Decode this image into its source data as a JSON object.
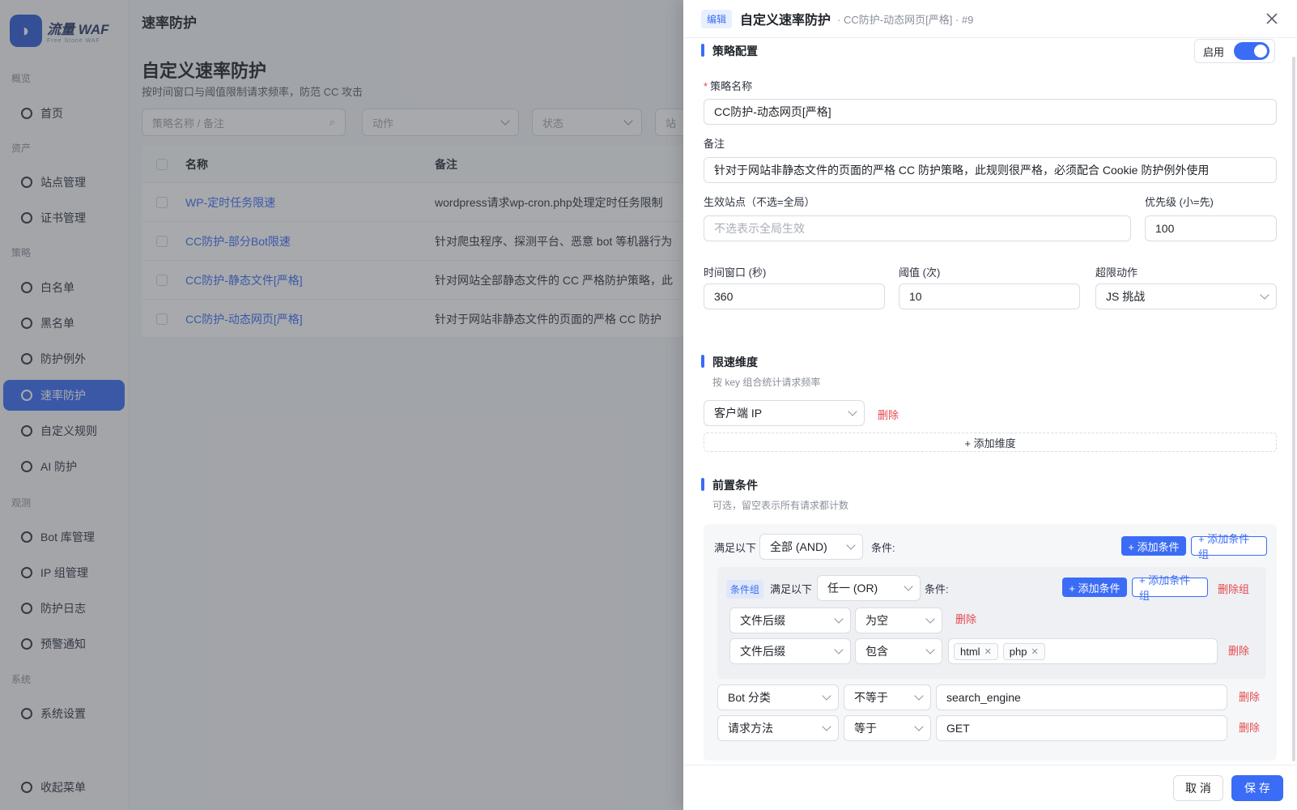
{
  "app": {
    "logo_title": "流量 WAF",
    "logo_sub": "Free Stone WAF",
    "page_header": "速率防护",
    "page_title": "自定义速率防护",
    "page_subtitle": "按时间窗口与阈值限制请求频率，防范 CC 攻击",
    "search_placeholder": "策略名称 / 备注",
    "filter_action": "动作",
    "filter_status": "状态",
    "filter_site": "站",
    "table_headers": {
      "name": "名称",
      "note": "备注"
    },
    "rows": [
      {
        "name": "WP-定时任务限速",
        "note": "wordpress请求wp-cron.php处理定时任务限制"
      },
      {
        "name": "CC防护-部分Bot限速",
        "note": "针对爬虫程序、探测平台、恶意 bot 等机器行为"
      },
      {
        "name": "CC防护-静态文件[严格]",
        "note": "针对网站全部静态文件的 CC 严格防护策略，此"
      },
      {
        "name": "CC防护-动态网页[严格]",
        "note": "针对于网站非静态文件的页面的严格 CC 防护"
      }
    ]
  },
  "sidebar": {
    "groups": [
      "概览",
      "资产",
      "策略",
      "观测",
      "系统"
    ],
    "items": [
      {
        "label": "首页",
        "icon": "home-icon"
      },
      {
        "label": "站点管理",
        "icon": "sites-icon"
      },
      {
        "label": "证书管理",
        "icon": "cert-icon"
      },
      {
        "label": "白名单",
        "icon": "whitelist-icon"
      },
      {
        "label": "黑名单",
        "icon": "blacklist-icon"
      },
      {
        "label": "防护例外",
        "icon": "exception-icon"
      },
      {
        "label": "速率防护",
        "icon": "rate-icon",
        "active": true
      },
      {
        "label": "自定义规则",
        "icon": "rules-icon"
      },
      {
        "label": "AI 防护",
        "icon": "ai-icon"
      },
      {
        "label": "Bot 库管理",
        "icon": "bot-icon"
      },
      {
        "label": "IP 组管理",
        "icon": "ipgroup-icon"
      },
      {
        "label": "防护日志",
        "icon": "log-icon"
      },
      {
        "label": "预警通知",
        "icon": "bell-icon"
      },
      {
        "label": "系统设置",
        "icon": "settings-icon"
      }
    ],
    "collapse_label": "收起菜单"
  },
  "drawer": {
    "tag": "编辑",
    "title": "自定义速率防护",
    "subtitle": "· CC防护-动态网页[严格] · #9",
    "section_config": "策略配置",
    "enable_label": "启用",
    "enabled": true,
    "fields": {
      "name_label": "策略名称",
      "name_value": "CC防护-动态网页[严格]",
      "note_label": "备注",
      "note_value": "针对于网站非静态文件的页面的严格 CC 防护策略，此规则很严格，必须配合 Cookie 防护例外使用",
      "sites_label": "生效站点（不选=全局）",
      "sites_placeholder": "不选表示全局生效",
      "priority_label": "优先级 (小=先)",
      "priority_value": "100",
      "window_label": "时间窗口 (秒)",
      "window_value": "360",
      "threshold_label": "阈值 (次)",
      "threshold_value": "10",
      "action_label": "超限动作",
      "action_value": "JS 挑战"
    },
    "section_dimension": "限速维度",
    "dimension_desc": "按 key 组合统计请求频率",
    "dimension_value": "客户端 IP",
    "delete_label": "删除",
    "add_dimension": "+ 添加维度",
    "section_conditions": "前置条件",
    "conditions_desc": "可选，留空表示所有请求都计数",
    "satisfy_label": "满足以下",
    "top_logic": "全部 (AND)",
    "cond_suffix": "条件:",
    "add_condition": "+ 添加条件",
    "add_condition_group": "+ 添加条件组",
    "group_tag": "条件组",
    "group_logic": "任一 (OR)",
    "delete_group": "删除组",
    "group_conditions": [
      {
        "field": "文件后缀",
        "op": "为空"
      },
      {
        "field": "文件后缀",
        "op": "包含",
        "chips": [
          "html",
          "php"
        ]
      }
    ],
    "conditions": [
      {
        "field": "Bot 分类",
        "op": "不等于",
        "value": "search_engine"
      },
      {
        "field": "请求方法",
        "op": "等于",
        "value": "GET"
      }
    ],
    "cancel": "取 消",
    "save": "保 存"
  },
  "colors": {
    "primary": "#3b6cf6",
    "danger": "#e5484d"
  }
}
